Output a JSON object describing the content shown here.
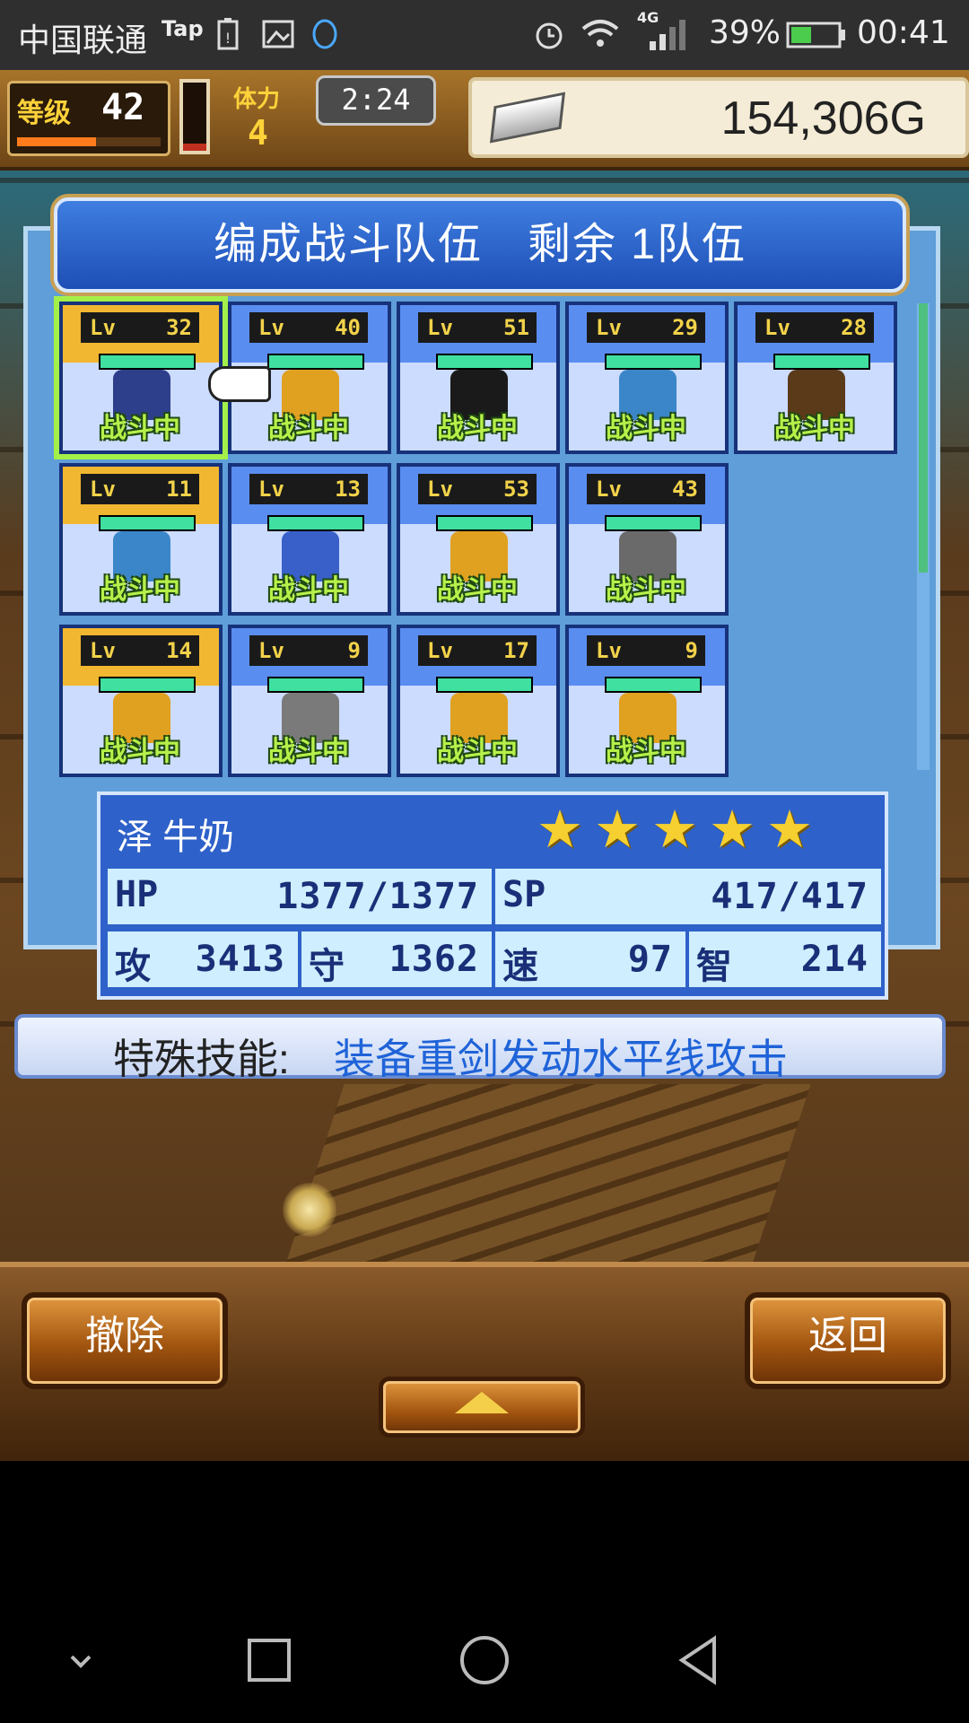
{
  "status_bar": {
    "carrier": "中国联通",
    "tap_label": "Tap",
    "network": "4G",
    "battery": "39%",
    "time": "00:41",
    "icons": [
      "warning-battery-icon",
      "image-icon",
      "qq-icon",
      "alarm-icon",
      "wifi-icon",
      "signal-icon",
      "battery-icon"
    ]
  },
  "hud": {
    "level_label": "等级",
    "level_value": "42",
    "exp_fraction": 0.55,
    "stamina_label": "体力",
    "stamina_value": "4",
    "stamina_fraction": 0.1,
    "timer": "2:24",
    "gold": "154,306G"
  },
  "panel": {
    "title": "编成战斗队伍　剩余 1队伍"
  },
  "members": [
    {
      "lv_label": "Lv",
      "lv": "32",
      "status": "战斗中",
      "leader": true,
      "selected": true,
      "color": "#2d3f8a"
    },
    {
      "lv_label": "Lv",
      "lv": "40",
      "status": "战斗中",
      "leader": false,
      "selected": false,
      "color": "#e0a020"
    },
    {
      "lv_label": "Lv",
      "lv": "51",
      "status": "战斗中",
      "leader": false,
      "selected": false,
      "color": "#1a1a1a"
    },
    {
      "lv_label": "Lv",
      "lv": "29",
      "status": "战斗中",
      "leader": false,
      "selected": false,
      "color": "#3b86c8"
    },
    {
      "lv_label": "Lv",
      "lv": "28",
      "status": "战斗中",
      "leader": false,
      "selected": false,
      "color": "#5b3a1a"
    },
    {
      "lv_label": "Lv",
      "lv": "11",
      "status": "战斗中",
      "leader": true,
      "selected": false,
      "color": "#3b86c8"
    },
    {
      "lv_label": "Lv",
      "lv": "13",
      "status": "战斗中",
      "leader": false,
      "selected": false,
      "color": "#3860c8"
    },
    {
      "lv_label": "Lv",
      "lv": "53",
      "status": "战斗中",
      "leader": false,
      "selected": false,
      "color": "#e0a020"
    },
    {
      "lv_label": "Lv",
      "lv": "43",
      "status": "战斗中",
      "leader": false,
      "selected": false,
      "color": "#6a6a6a"
    },
    {
      "lv_label": "Lv",
      "lv": "14",
      "status": "战斗中",
      "leader": true,
      "selected": false,
      "color": "#e0a020"
    },
    {
      "lv_label": "Lv",
      "lv": "9",
      "status": "战斗中",
      "leader": false,
      "selected": false,
      "color": "#7a7a7a"
    },
    {
      "lv_label": "Lv",
      "lv": "17",
      "status": "战斗中",
      "leader": false,
      "selected": false,
      "color": "#e0a020"
    },
    {
      "lv_label": "Lv",
      "lv": "9",
      "status": "战斗中",
      "leader": false,
      "selected": false,
      "color": "#e0a020"
    }
  ],
  "selected_unit": {
    "name": "泽 牛奶",
    "stars": 5,
    "star_glyph": "★",
    "hp_label": "HP",
    "hp": "1377/1377",
    "sp_label": "SP",
    "sp": "417/417",
    "atk_label": "攻",
    "atk": "3413",
    "def_label": "守",
    "def": "1362",
    "spd_label": "速",
    "spd": "97",
    "int_label": "智",
    "int": "214"
  },
  "skill": {
    "label": "特殊技能:",
    "value": "装备重剑发动水平线攻击"
  },
  "buttons": {
    "remove": "撤除",
    "back": "返回"
  },
  "nav": {
    "icons": [
      "chevron-down-icon",
      "recent-apps-icon",
      "home-icon",
      "back-icon"
    ]
  }
}
